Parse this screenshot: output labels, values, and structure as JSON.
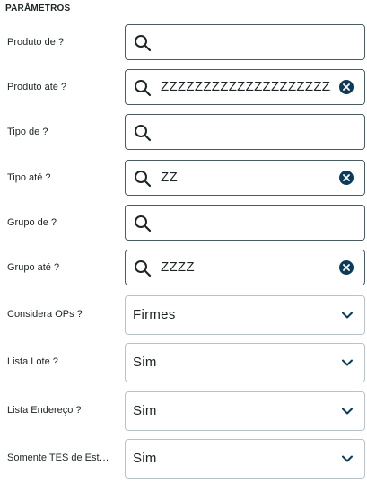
{
  "section": {
    "title": "PARÂMETROS"
  },
  "colors": {
    "accent": "#0c3a5a",
    "border": "#4a5c60",
    "select_border": "#b8c4c8"
  },
  "params": [
    {
      "label": "Produto de ?",
      "type": "lookup",
      "value": "",
      "clearable": false
    },
    {
      "label": "Produto até ?",
      "type": "lookup",
      "value": "ZZZZZZZZZZZZZZZZZZZZZZZ",
      "clearable": true
    },
    {
      "label": "Tipo de ?",
      "type": "lookup",
      "value": "",
      "clearable": false
    },
    {
      "label": "Tipo até ?",
      "type": "lookup",
      "value": "ZZ",
      "clearable": true
    },
    {
      "label": "Grupo de ?",
      "type": "lookup",
      "value": "",
      "clearable": false
    },
    {
      "label": "Grupo até ?",
      "type": "lookup",
      "value": "ZZZZ",
      "clearable": true
    },
    {
      "label": "Considera OPs ?",
      "type": "select",
      "value": "Firmes"
    },
    {
      "label": "Lista Lote ?",
      "type": "select",
      "value": "Sim"
    },
    {
      "label": "Lista Endereço ?",
      "type": "select",
      "value": "Sim"
    },
    {
      "label": "Somente TES de Estoque ?",
      "type": "select",
      "value": "Sim"
    }
  ],
  "icons": {
    "search": "search-icon",
    "clear": "clear-icon",
    "chevron": "chevron-down-icon"
  }
}
